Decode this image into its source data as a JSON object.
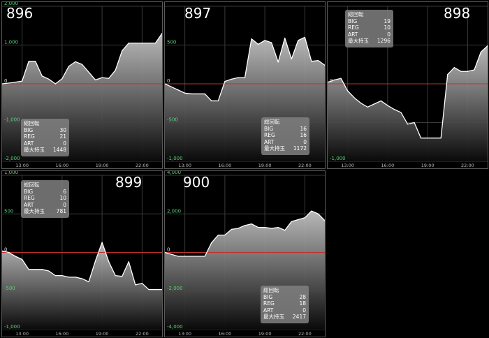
{
  "colors": {
    "background": "#000000",
    "grid": "#3a3a3a",
    "zero_line": "#c0302f",
    "pos_label": "#57d37a",
    "neg_label": "#57d37a",
    "x_label": "#bbbbbb",
    "line": "#ffffff"
  },
  "stats_labels": {
    "title": "総回転",
    "big": "BIG",
    "reg": "REG",
    "art": "ART",
    "max": "最大持玉"
  },
  "chart_data": [
    {
      "type": "area",
      "machine": "896",
      "ylim": [
        -2000,
        2000
      ],
      "yticks": [
        2000,
        1000,
        0,
        -1000,
        -2000
      ],
      "ytick_labels": [
        "2,000",
        "1,000",
        "0",
        "-1,000",
        "-2,000"
      ],
      "xlim": [
        0,
        24
      ],
      "xticks": [
        3,
        9,
        15,
        21
      ],
      "xtick_labels": [
        "13:00",
        "16:00",
        "19:00",
        "22:00"
      ],
      "x": [
        0,
        1.5,
        3,
        4,
        5,
        6,
        7,
        8,
        9,
        10,
        11,
        12,
        13,
        14,
        15,
        16,
        17,
        18,
        19,
        20,
        21,
        22,
        23,
        24
      ],
      "y": [
        0,
        30,
        70,
        580,
        580,
        200,
        120,
        0,
        130,
        450,
        570,
        500,
        300,
        100,
        160,
        140,
        350,
        850,
        1050,
        1050,
        1050,
        1050,
        1050,
        1300
      ],
      "stats": {
        "big": "30",
        "reg": "21",
        "art": "0",
        "max": "1448"
      }
    },
    {
      "type": "area",
      "machine": "897",
      "ylim": [
        -1000,
        1000
      ],
      "yticks": [
        1000,
        500,
        0,
        -500,
        -1000
      ],
      "ytick_labels": [
        "",
        "500",
        "0",
        "-500",
        "-1,000"
      ],
      "xlim": [
        0,
        24
      ],
      "xticks": [
        3,
        9,
        15,
        21
      ],
      "xtick_labels": [
        "13:00",
        "16:00",
        "19:00",
        "22:00"
      ],
      "x": [
        0,
        1,
        2,
        3,
        4,
        5,
        6,
        7,
        8,
        9,
        10,
        11,
        12,
        13,
        14,
        15,
        16,
        17,
        18,
        19,
        20,
        21,
        22,
        23,
        24
      ],
      "y": [
        0,
        -40,
        -80,
        -120,
        -130,
        -130,
        -130,
        -220,
        -220,
        30,
        60,
        80,
        80,
        580,
        510,
        560,
        530,
        280,
        590,
        320,
        560,
        600,
        290,
        300,
        240
      ],
      "stats": {
        "big": "16",
        "reg": "16",
        "art": "0",
        "max": "1172"
      }
    },
    {
      "type": "area",
      "machine": "898",
      "ylim": [
        -1000,
        1000
      ],
      "yticks": [
        1000,
        500,
        0,
        -500,
        -1000
      ],
      "ytick_labels": [
        "",
        "",
        "0",
        "",
        "-1,000"
      ],
      "xlim": [
        0,
        24
      ],
      "xticks": [
        3,
        9,
        15,
        21
      ],
      "xtick_labels": [
        "13:00",
        "16:00",
        "19:00",
        "22:00"
      ],
      "x": [
        0,
        1,
        2,
        3,
        4,
        5,
        6,
        7,
        8,
        9,
        10,
        11,
        12,
        13,
        14,
        15,
        16,
        17,
        18,
        19,
        20,
        21,
        22,
        23,
        24
      ],
      "y": [
        20,
        50,
        70,
        -90,
        -180,
        -250,
        -300,
        -260,
        -220,
        -280,
        -330,
        -370,
        -520,
        -500,
        -700,
        -700,
        -700,
        -700,
        120,
        210,
        160,
        160,
        180,
        410,
        490
      ],
      "stats": {
        "big": "19",
        "reg": "10",
        "art": "0",
        "max": "1296"
      }
    },
    {
      "type": "area",
      "machine": "899",
      "ylim": [
        -1000,
        1000
      ],
      "yticks": [
        1000,
        500,
        0,
        -500,
        -1000
      ],
      "ytick_labels": [
        "1,000",
        "500",
        "0",
        "-500",
        "-1,000"
      ],
      "xlim": [
        0,
        24
      ],
      "xticks": [
        3,
        9,
        15,
        21
      ],
      "xtick_labels": [
        "13:00",
        "16:00",
        "19:00",
        "22:00"
      ],
      "x": [
        0,
        1,
        2,
        3,
        4,
        5,
        6,
        7,
        8,
        9,
        10,
        11,
        12,
        13,
        14,
        15,
        16,
        17,
        18,
        19,
        20,
        21,
        22,
        23,
        24
      ],
      "y": [
        20,
        0,
        -50,
        -90,
        -220,
        -220,
        -220,
        -240,
        -300,
        -300,
        -320,
        -320,
        -340,
        -380,
        -110,
        130,
        -120,
        -300,
        -310,
        -120,
        -420,
        -400,
        -480,
        -480,
        -480
      ],
      "stats": {
        "big": "6",
        "reg": "10",
        "art": "0",
        "max": "781"
      }
    },
    {
      "type": "area",
      "machine": "900",
      "ylim": [
        -4000,
        4000
      ],
      "yticks": [
        4000,
        2000,
        0,
        -2000,
        -4000
      ],
      "ytick_labels": [
        "4,000",
        "2,000",
        "0",
        "-2,000",
        "-4,000"
      ],
      "xlim": [
        0,
        24
      ],
      "xticks": [
        3,
        9,
        15,
        21
      ],
      "xtick_labels": [
        "13:00",
        "16:00",
        "19:00",
        "22:00"
      ],
      "x": [
        0,
        1,
        2,
        3,
        4,
        5,
        6,
        7,
        8,
        9,
        10,
        11,
        12,
        13,
        14,
        15,
        16,
        17,
        18,
        19,
        20,
        21,
        22,
        23,
        24
      ],
      "y": [
        0,
        -100,
        -200,
        -200,
        -200,
        -200,
        -200,
        500,
        900,
        900,
        1200,
        1250,
        1400,
        1480,
        1300,
        1300,
        1250,
        1300,
        1150,
        1600,
        1700,
        1800,
        2150,
        2000,
        1650
      ],
      "stats": {
        "big": "28",
        "reg": "18",
        "art": "0",
        "max": "2417"
      }
    }
  ]
}
